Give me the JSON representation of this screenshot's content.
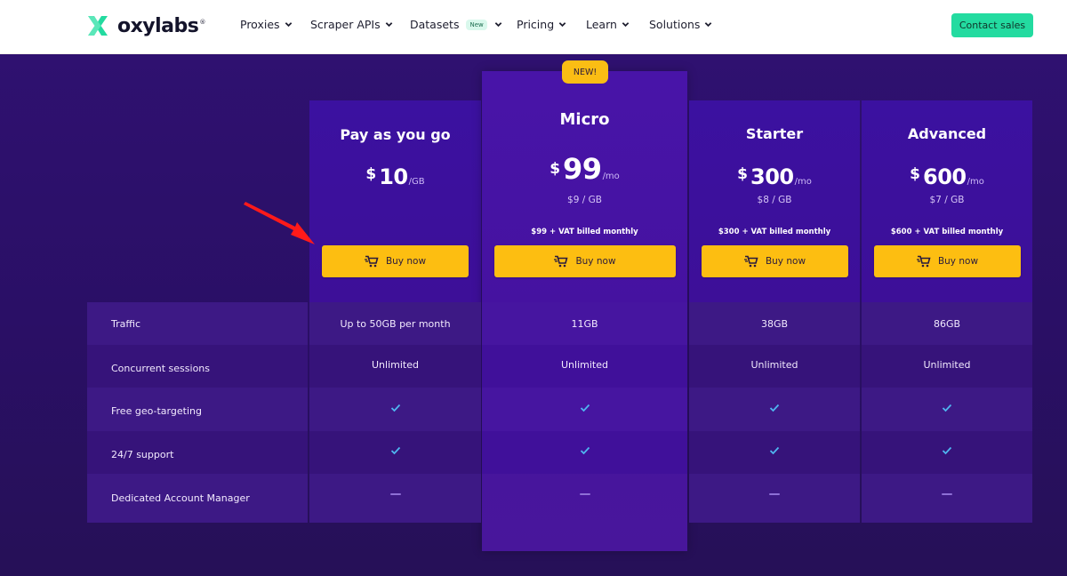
{
  "header": {
    "logo_text": "oxylabs",
    "logo_mark": "registered",
    "nav": [
      {
        "label": "Proxies",
        "icon": "chevron-down-icon"
      },
      {
        "label": "Scraper APIs",
        "icon": "chevron-down-icon"
      },
      {
        "label": "Datasets",
        "badge": "New",
        "icon": "chevron-down-icon"
      },
      {
        "label": "Pricing",
        "icon": "chevron-down-icon"
      },
      {
        "label": "Learn",
        "icon": "chevron-down-icon"
      },
      {
        "label": "Solutions",
        "icon": "chevron-down-icon"
      }
    ],
    "contact_label": "Contact sales"
  },
  "colors": {
    "brand_green": "#23dba0",
    "buy_yellow": "#fdbe11",
    "background_purple": "#2a1064",
    "highlight_purple": "#4814a8",
    "check_blue": "#4fb6f0",
    "annotation_red": "#ff1a1a"
  },
  "plans": [
    {
      "name": "Pay as you go",
      "currency": "$",
      "price": "10",
      "unit": "/GB",
      "per_gb": "",
      "billed": "",
      "buy_label": "Buy now"
    },
    {
      "name": "Micro",
      "badge": "NEW!",
      "currency": "$",
      "price": "99",
      "unit": "/mo",
      "per_gb": "$9 / GB",
      "billed": "$99 + VAT billed monthly",
      "buy_label": "Buy now"
    },
    {
      "name": "Starter",
      "currency": "$",
      "price": "300",
      "unit": "/mo",
      "per_gb": "$8 / GB",
      "billed": "$300 + VAT billed monthly",
      "buy_label": "Buy now"
    },
    {
      "name": "Advanced",
      "currency": "$",
      "price": "600",
      "unit": "/mo",
      "per_gb": "$7 / GB",
      "billed": "$600 + VAT billed monthly",
      "buy_label": "Buy now"
    }
  ],
  "features": [
    {
      "label": "Traffic",
      "values": [
        "Up to 50GB per month",
        "11GB",
        "38GB",
        "86GB"
      ]
    },
    {
      "label": "Concurrent sessions",
      "values": [
        "Unlimited",
        "Unlimited",
        "Unlimited",
        "Unlimited"
      ]
    },
    {
      "label": "Free geo-targeting",
      "values": [
        "check",
        "check",
        "check",
        "check"
      ]
    },
    {
      "label": "24/7 support",
      "values": [
        "check",
        "check",
        "check",
        "check"
      ]
    },
    {
      "label": "Dedicated Account Manager",
      "values": [
        "dash",
        "dash",
        "dash",
        "dash"
      ]
    }
  ],
  "annotation": {
    "icon": "red-arrow-icon",
    "points_to": "Pay as you go Buy now button"
  }
}
